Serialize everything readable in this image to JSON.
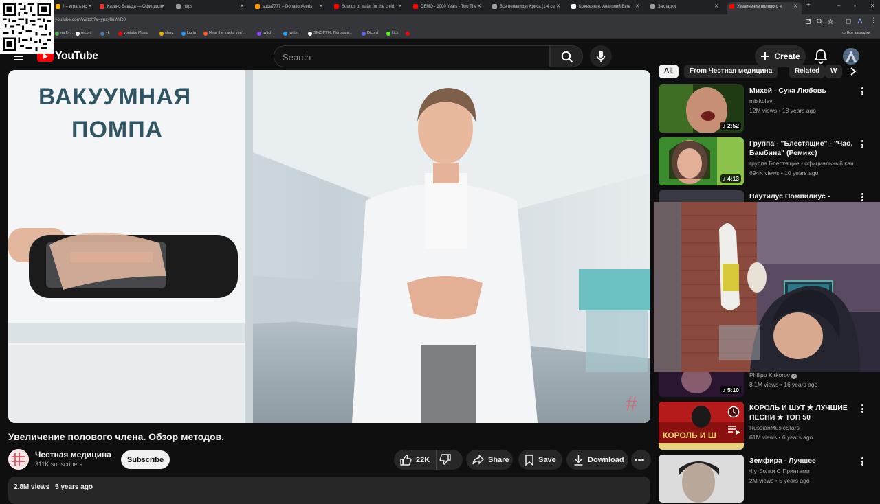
{
  "browser": {
    "tabs": [
      {
        "label": "! – играть но",
        "fav": "#f4b400"
      },
      {
        "label": "Казино Вавада — Официаль",
        "fav": "#e53935"
      },
      {
        "label": "https",
        "fav": "#9e9e9e"
      },
      {
        "label": "supa7777 – DonationAlerts",
        "fav": "#ff9800"
      },
      {
        "label": "Sounds of water for the child",
        "fav": "#ff0000"
      },
      {
        "label": "DEMO - 2000 Years - Two The",
        "fav": "#ff0000"
      },
      {
        "label": "Все ненавидят Криса (1-4 се",
        "fav": "#9e9e9e"
      },
      {
        "label": "Кожемякин, Анатолий Евге",
        "fav": "#ffffff"
      },
      {
        "label": "Закладки",
        "fav": "#9e9e9e"
      },
      {
        "label": "Увеличение полового ч",
        "fav": "#ff0000"
      }
    ],
    "url": "youtube.com/watch?v=ypxylluWrR0",
    "bookmarks": [
      {
        "label": "на Гл...",
        "color": "#4caf50"
      },
      {
        "label": "record",
        "color": "#ffffff"
      },
      {
        "label": "vk",
        "color": "#4a76a8"
      },
      {
        "label": "youtube Music",
        "color": "#ff0000"
      },
      {
        "label": "ebay",
        "color": "#f4b400"
      },
      {
        "label": "log in",
        "color": "#2196f3"
      },
      {
        "label": "Hear the tracks you'...",
        "color": "#ff5722"
      },
      {
        "label": "twitch",
        "color": "#9146ff"
      },
      {
        "label": "twitter",
        "color": "#1da1f2"
      },
      {
        "label": "SINOPTIK: Погода в...",
        "color": "#ffffff"
      },
      {
        "label": "Dicord",
        "color": "#5865f2"
      },
      {
        "label": "kick",
        "color": "#53fc18"
      },
      {
        "label": "",
        "color": "#ff0000"
      }
    ],
    "all_bookmarks": "Все закладки"
  },
  "youtube": {
    "logo": "YouTube",
    "search_placeholder": "Search",
    "create_label": "Create"
  },
  "video": {
    "overlay_line1": "ВАКУУМНАЯ",
    "overlay_line2": "ПОМПА",
    "title": "Увеличение полового члена. Обзор методов.",
    "channel": "Честная медицина",
    "subscribers": "311K subscribers",
    "subscribe_label": "Subscribe",
    "likes": "22K",
    "share_label": "Share",
    "save_label": "Save",
    "download_label": "Download",
    "views": "2.8M views",
    "age": "5 years ago"
  },
  "sidebar": {
    "chips": [
      "All",
      "From Честная медицина",
      "Related",
      "W"
    ],
    "recommendations": [
      {
        "title": "Михей - Сука Любовь",
        "channel": "mblkolavl",
        "meta": "12M views • 18 years ago",
        "duration": "2:52"
      },
      {
        "title": "Группа - \"Блестящие\" - \"Чао, Бамбина\" (Ремикс)",
        "channel": "группа Блестящие - официальный кан...",
        "meta": "694K views • 10 years ago",
        "duration": "4:13"
      },
      {
        "title": "Наутилус Помпилиус - \"Зверь\"",
        "channel": "",
        "meta": "",
        "duration": ""
      },
      {
        "title": "",
        "channel": "Philipp Kirkorov",
        "meta": "8.1M views • 16 years ago",
        "duration": "5:10"
      },
      {
        "title": "КОРОЛЬ И ШУТ ★ ЛУЧШИЕ ПЕСНИ ★ ТОП 50",
        "channel": "RussianMusicStars",
        "meta": "61M views • 6 years ago",
        "duration": ""
      },
      {
        "title": "Земфира - Лучшее",
        "channel": "Футболки С Принтами",
        "meta": "2M views • 5 years ago",
        "duration": ""
      }
    ],
    "kish_thumb_text": "КОРОЛЬ И Ш"
  }
}
